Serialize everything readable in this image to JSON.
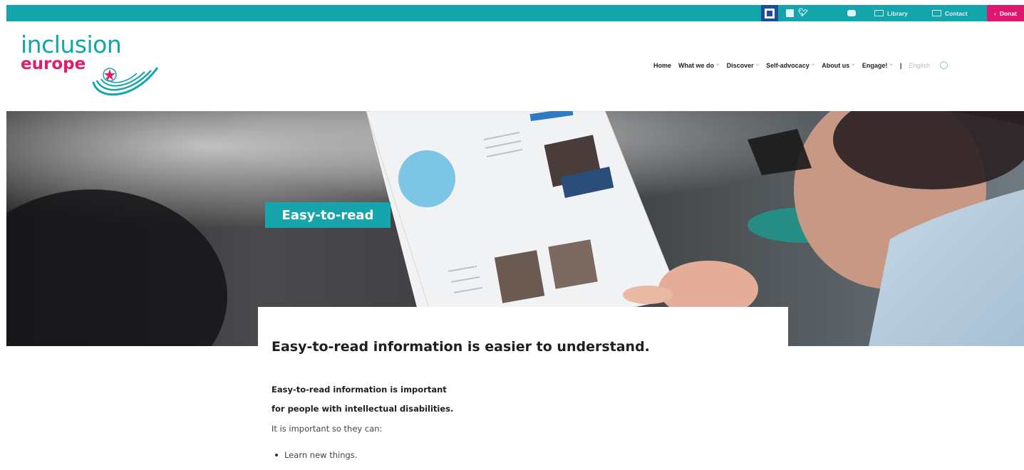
{
  "topbar": {
    "library": "Library",
    "contact": "Contact",
    "donate": "Donat",
    "donate_icon": "‹"
  },
  "logo": {
    "line1": "inclusion",
    "line2": "europe"
  },
  "nav": {
    "items": [
      {
        "label": "Home",
        "dropdown": false
      },
      {
        "label": "What we do",
        "dropdown": true
      },
      {
        "label": "Discover",
        "dropdown": true
      },
      {
        "label": "Self-advocacy",
        "dropdown": true
      },
      {
        "label": "About us",
        "dropdown": true
      },
      {
        "label": "Engage!",
        "dropdown": true
      }
    ],
    "separator": "|",
    "language": "English"
  },
  "hero": {
    "label": "Easy-to-read"
  },
  "content": {
    "title": "Easy-to-read information is easier to understand.",
    "bold_line_1": "Easy-to-read information is important",
    "bold_line_2": "for people with intellectual disabilities.",
    "paragraph": "It is important so they can:",
    "bullets": [
      "Learn new things."
    ]
  },
  "colors": {
    "teal": "#14a5ac",
    "pink": "#e0176e",
    "easy_to_read_blue": "#1c4c9c"
  }
}
